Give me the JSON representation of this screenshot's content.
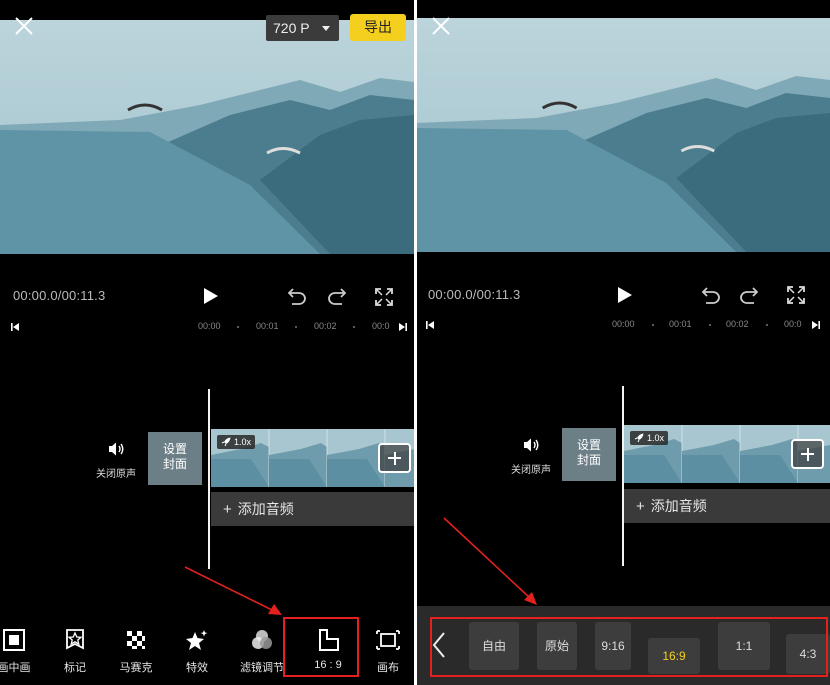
{
  "left": {
    "resolution": "720 P",
    "export_label": "导出",
    "timecode": "00:00.0/00:11.3",
    "ruler": [
      "00:00",
      "00:01",
      "00:02",
      "00:0"
    ],
    "mute_label": "关闭原声",
    "cover_label_line1": "设置",
    "cover_label_line2": "封面",
    "speed": "1.0x",
    "add_audio": "添加音频",
    "toolbar": [
      {
        "label": "画中画",
        "icon": "picture-in-picture-icon"
      },
      {
        "label": "标记",
        "icon": "star-badge-icon"
      },
      {
        "label": "马赛克",
        "icon": "mosaic-icon"
      },
      {
        "label": "特效",
        "icon": "sparkle-icon"
      },
      {
        "label": "滤镜调节",
        "icon": "filter-icon"
      },
      {
        "label": "16 : 9",
        "icon": "aspect-ratio-icon"
      },
      {
        "label": "画布",
        "icon": "canvas-icon"
      }
    ]
  },
  "right": {
    "timecode": "00:00.0/00:11.3",
    "ruler": [
      "00:00",
      "00:01",
      "00:02",
      "00:0"
    ],
    "mute_label": "关闭原声",
    "cover_label_line1": "设置",
    "cover_label_line2": "封面",
    "speed": "1.0x",
    "add_audio": "添加音频",
    "ratios": [
      "自由",
      "原始",
      "9:16",
      "16:9",
      "1:1",
      "4:3"
    ],
    "selected_ratio": "16:9"
  },
  "colors": {
    "accent_yellow": "#f4cf1e",
    "highlight_red": "#e3211e",
    "background": "#000000"
  }
}
